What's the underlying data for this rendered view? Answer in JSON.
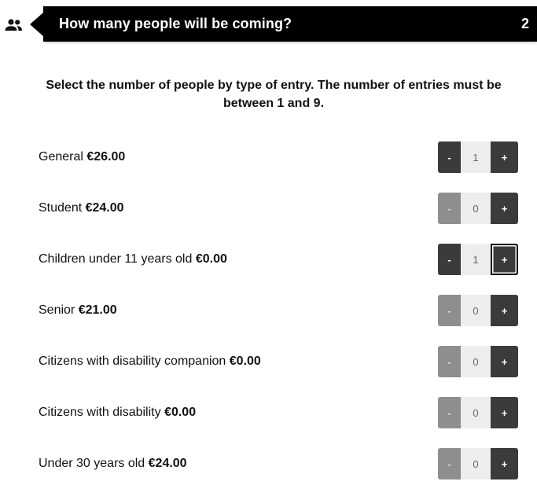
{
  "header": {
    "icon": "people-icon",
    "title": "How many people will be coming?",
    "step": "2"
  },
  "instructions": "Select the number of people by type of entry. The number of entries must be between 1 and 9.",
  "tickets": [
    {
      "name": "General",
      "price": "€26.00",
      "quantity": "1",
      "minus_enabled": true,
      "minus_label": "-",
      "plus_label": "+"
    },
    {
      "name": "Student",
      "price": "€24.00",
      "quantity": "0",
      "minus_enabled": false,
      "minus_label": "-",
      "plus_label": "+"
    },
    {
      "name": "Children under 11 years old",
      "price": "€0.00",
      "quantity": "1",
      "minus_enabled": true,
      "minus_label": "-",
      "plus_label": "+",
      "plus_focused": true
    },
    {
      "name": "Senior",
      "price": "€21.00",
      "quantity": "0",
      "minus_enabled": false,
      "minus_label": "-",
      "plus_label": "+"
    },
    {
      "name": "Citizens with disability companion",
      "price": "€0.00",
      "quantity": "0",
      "minus_enabled": false,
      "minus_label": "-",
      "plus_label": "+"
    },
    {
      "name": "Citizens with disability",
      "price": "€0.00",
      "quantity": "0",
      "minus_enabled": false,
      "minus_label": "-",
      "plus_label": "+"
    },
    {
      "name": "Under 30 years old",
      "price": "€24.00",
      "quantity": "0",
      "minus_enabled": false,
      "minus_label": "-",
      "plus_label": "+"
    }
  ],
  "colors": {
    "header_bg": "#000000",
    "button_enabled": "#3b3b3b",
    "button_disabled": "#8e8e8e",
    "quantity_bg": "#ededed"
  }
}
